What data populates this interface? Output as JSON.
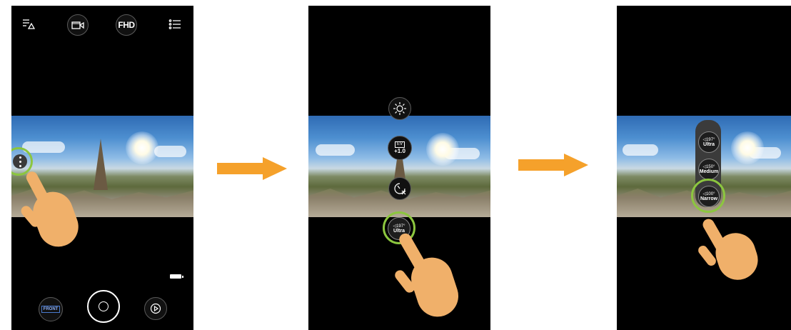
{
  "phone1": {
    "fhd_label": "FHD",
    "front_label": "FRONT"
  },
  "phone2": {
    "ev_label": "EV",
    "ev_value": "+1.0",
    "fov_degree": "◁197°",
    "fov_name": "Ultra"
  },
  "phone3": {
    "options": [
      {
        "degree": "◁197°",
        "name": "Ultra"
      },
      {
        "degree": "◁150°",
        "name": "Medium"
      },
      {
        "degree": "◁100°",
        "name": "Narrow"
      }
    ]
  },
  "colors": {
    "highlight_ring": "#8cc63f",
    "arrow": "#f5a12b",
    "hand": "#f0b06a"
  },
  "icons": [
    "filter-icon",
    "video-mode-icon",
    "settings-list-icon",
    "more-options-icon",
    "shutter-icon",
    "playback-icon",
    "battery-icon",
    "brightness-icon",
    "timer-off-icon",
    "fov-icon"
  ]
}
